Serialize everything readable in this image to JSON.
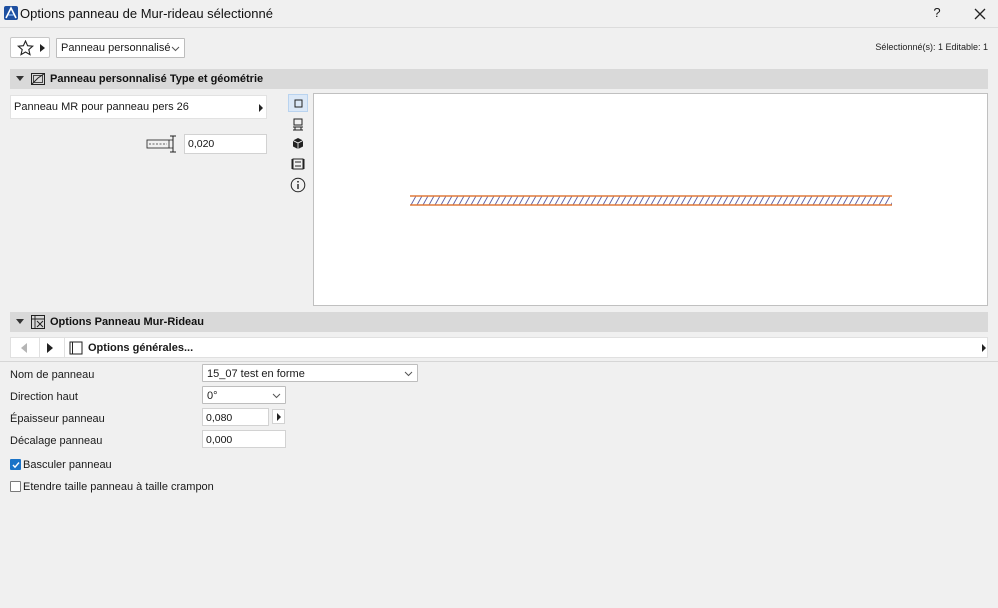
{
  "window": {
    "title": "Options panneau de Mur-rideau sélectionné",
    "help_label": "?"
  },
  "toolbar": {
    "preset_value": "Panneau personnalisé",
    "selection_info": "Sélectionné(s): 1 Editable: 1"
  },
  "section_geometry": {
    "title": "Panneau personnalisé Type et géométrie",
    "panel_type": "Panneau MR pour panneau pers 26",
    "thickness_value": "0,020"
  },
  "section_options": {
    "title": "Options Panneau Mur-Rideau",
    "page_label": "Options générales...",
    "fields": {
      "name_label": "Nom de panneau",
      "name_value": "15_07 test en forme",
      "direction_label": "Direction haut",
      "direction_value": "0°",
      "thickness_label": "Épaisseur panneau",
      "thickness_value": "0,080",
      "offset_label": "Décalage panneau",
      "offset_value": "0,000"
    },
    "checkboxes": {
      "flip_label": "Basculer panneau",
      "flip_checked": true,
      "extend_label": "Etendre taille panneau à taille crampon",
      "extend_checked": false
    }
  },
  "colors": {
    "accent": "#1a73c7",
    "hatch_line": "#e07a3a",
    "hatch_stroke": "#5a5aa0"
  }
}
